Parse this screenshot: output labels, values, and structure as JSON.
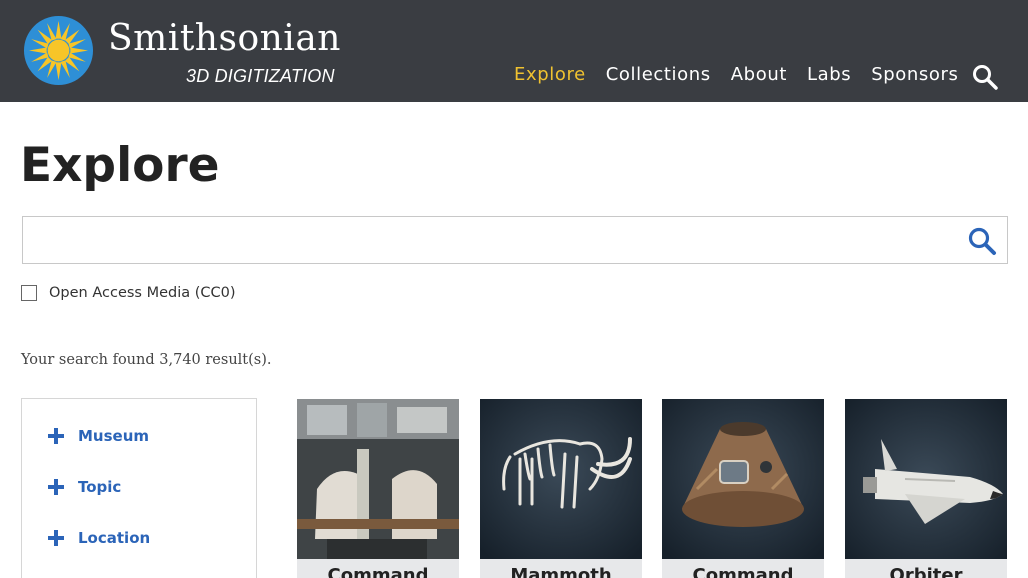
{
  "header": {
    "brand_name": "Smithsonian",
    "brand_sub": "3D DIGITIZATION",
    "nav": [
      "Explore",
      "Collections",
      "About",
      "Labs",
      "Sponsors"
    ],
    "active_nav": "Explore",
    "accent_color": "#f0c230",
    "background_color": "#3a3d42",
    "search_icon": "search-icon",
    "logo_icon": "smithsonian-sun-icon"
  },
  "main": {
    "page_title": "Explore",
    "search": {
      "value": "",
      "placeholder": "",
      "icon": "search-icon"
    },
    "cc0_checkbox": {
      "label": "Open Access Media (CC0)",
      "checked": false
    },
    "result_count": "Your search found 3,740 result(s)."
  },
  "filters": {
    "items": [
      {
        "label": "Museum",
        "icon": "plus-icon"
      },
      {
        "label": "Topic",
        "icon": "plus-icon"
      },
      {
        "label": "Location",
        "icon": "plus-icon"
      }
    ],
    "link_color": "#2b64b8"
  },
  "results": [
    {
      "title": "Command",
      "thumbnail": "cockpit-interior-thumbnail"
    },
    {
      "title": "Mammoth",
      "thumbnail": "mammoth-skeleton-thumbnail"
    },
    {
      "title": "Command",
      "thumbnail": "command-module-capsule-thumbnail"
    },
    {
      "title": "Orbiter",
      "thumbnail": "space-shuttle-thumbnail"
    }
  ]
}
